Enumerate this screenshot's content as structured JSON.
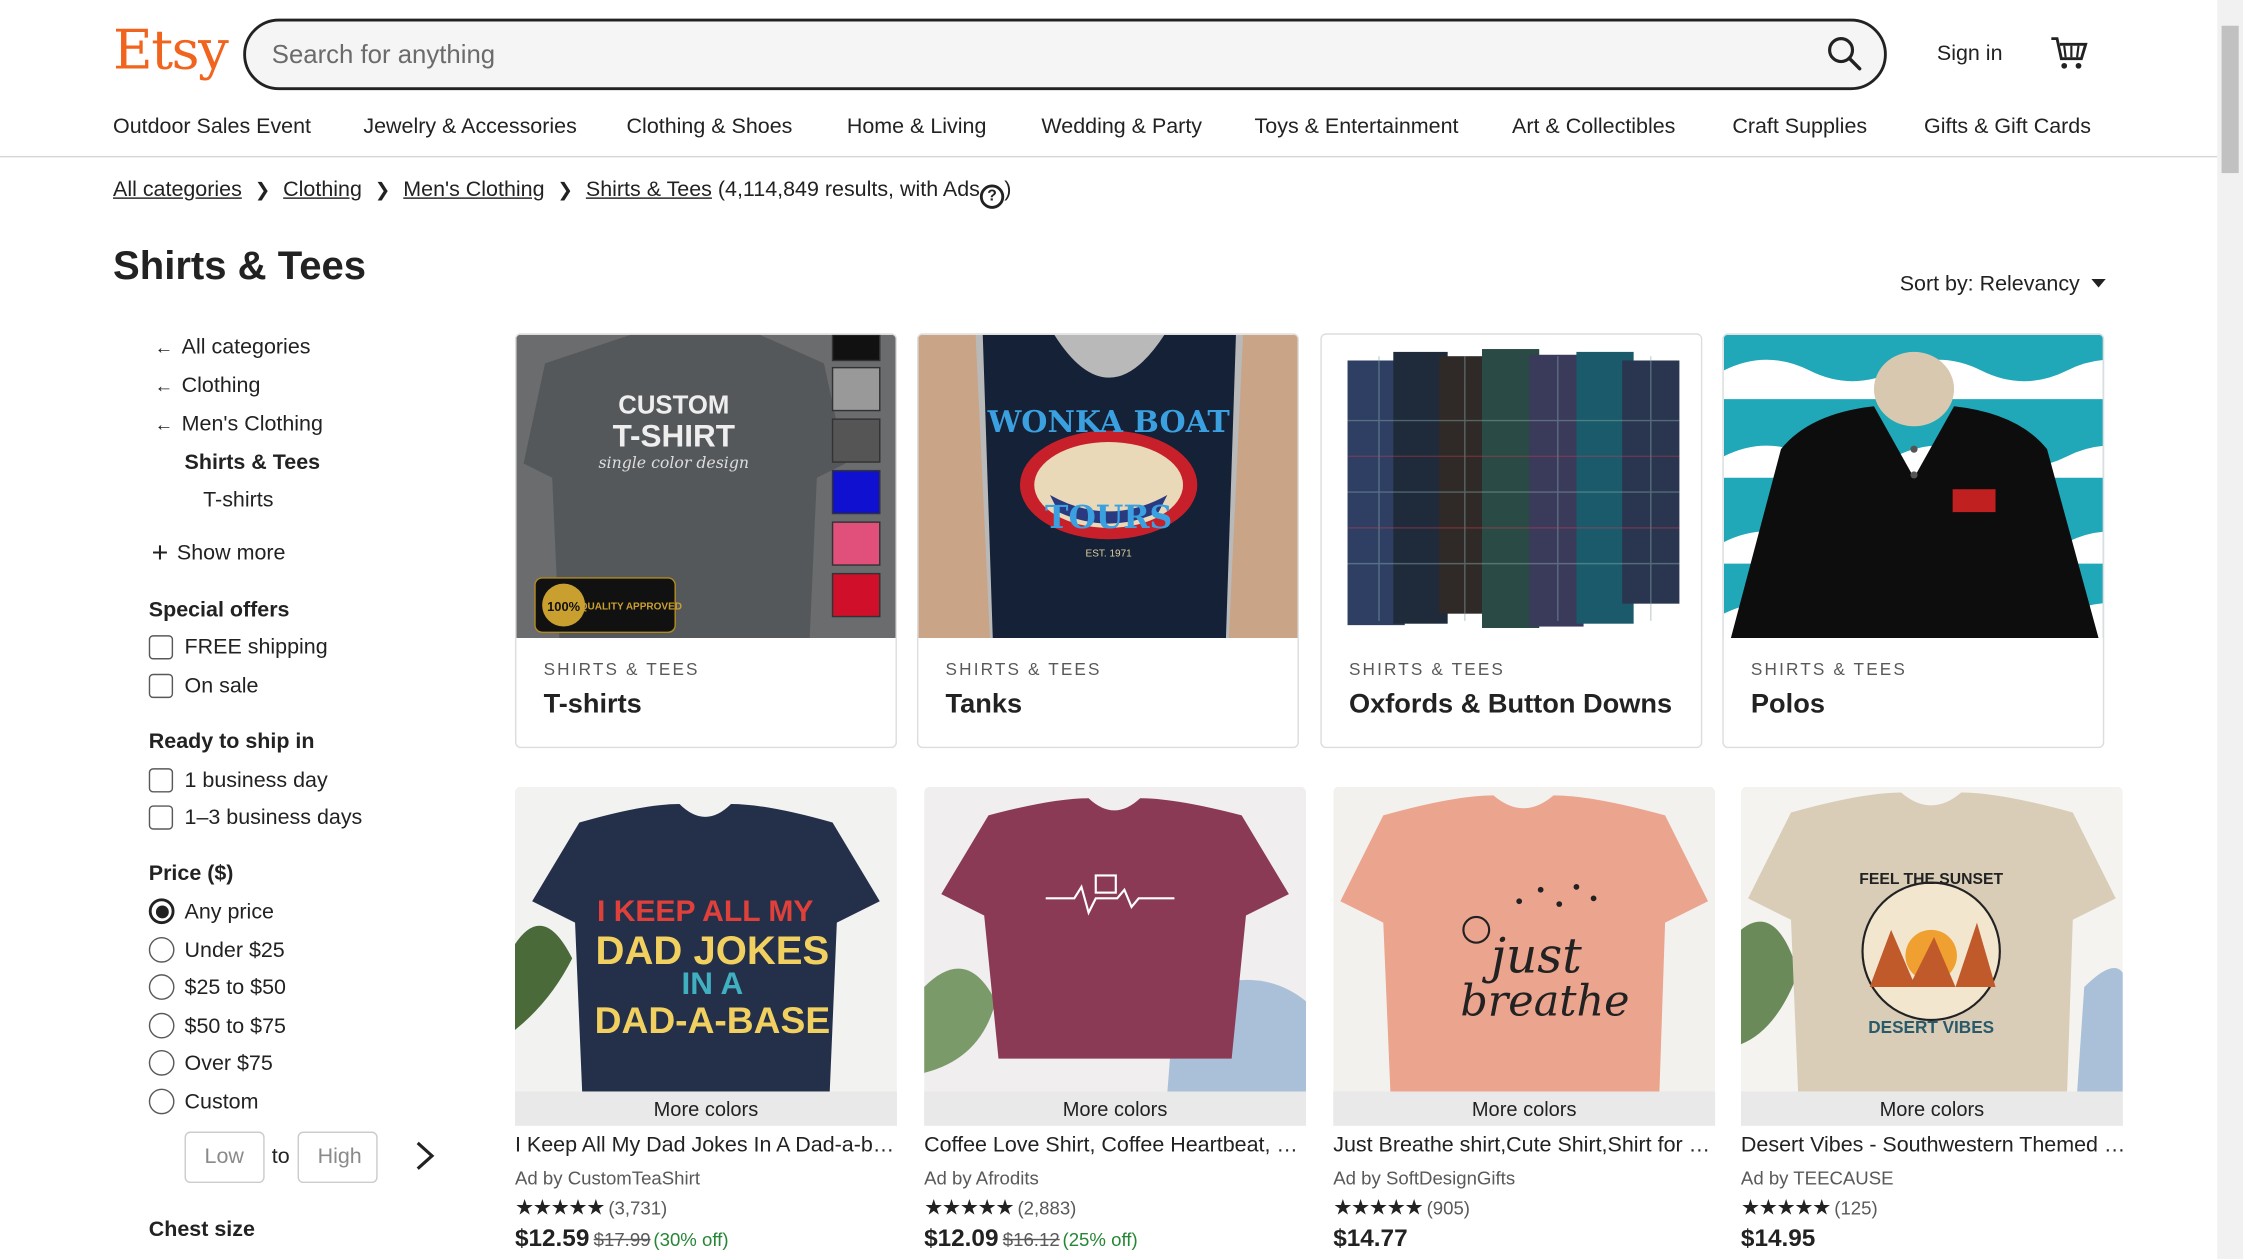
{
  "header": {
    "logo": "Etsy",
    "search_placeholder": "Search for anything",
    "sign_in": "Sign in"
  },
  "categories": [
    "Outdoor Sales Event",
    "Jewelry & Accessories",
    "Clothing & Shoes",
    "Home & Living",
    "Wedding & Party",
    "Toys & Entertainment",
    "Art & Collectibles",
    "Craft Supplies",
    "Gifts & Gift Cards"
  ],
  "breadcrumb": {
    "items": [
      "All categories",
      "Clothing",
      "Men's Clothing",
      "Shirts & Tees"
    ],
    "results": "(4,114,849 results, with Ads",
    "close": ")"
  },
  "page_title": "Shirts & Tees",
  "sort": "Sort by: Relevancy",
  "sidebar": {
    "nav": [
      "All categories",
      "Clothing",
      "Men's Clothing"
    ],
    "current": "Shirts & Tees",
    "child": "T-shirts",
    "show_more": "Show more",
    "special_offers": {
      "title": "Special offers",
      "options": [
        "FREE shipping",
        "On sale"
      ]
    },
    "ready_to_ship": {
      "title": "Ready to ship in",
      "options": [
        "1 business day",
        "1–3 business days"
      ]
    },
    "price": {
      "title": "Price ($)",
      "options": [
        "Any price",
        "Under $25",
        "$25 to $50",
        "$50 to $75",
        "Over $75",
        "Custom"
      ],
      "selected": "Any price",
      "low_placeholder": "Low",
      "to": "to",
      "high_placeholder": "High"
    },
    "chest_size": "Chest size"
  },
  "tiles": [
    {
      "kicker": "SHIRTS & TEES",
      "label": "T-shirts"
    },
    {
      "kicker": "SHIRTS & TEES",
      "label": "Tanks"
    },
    {
      "kicker": "SHIRTS & TEES",
      "label": "Oxfords & Button Downs"
    },
    {
      "kicker": "SHIRTS & TEES",
      "label": "Polos"
    }
  ],
  "tile_art": {
    "tshirt_line1": "CUSTOM",
    "tshirt_line2": "T-SHIRT",
    "tshirt_line3": "single color design",
    "badge": "100%",
    "badge_text": "QUALITY APPROVED",
    "tank_line1": "WONKA BOAT",
    "tank_line2": "TOURS",
    "tank_line3": "EST. 1971"
  },
  "listings": [
    {
      "more": "More colors",
      "name": "I Keep All My Dad Jokes In A Dad-a-base Shirt",
      "shop": "Ad by CustomTeaShirt",
      "stars": "★★★★★",
      "reviews": "(3,731)",
      "price": "$12.59",
      "was": "$17.99",
      "off": "(30% off)",
      "art": [
        "I KEEP ALL MY",
        "DAD JOKES",
        "IN A",
        "DAD-A-BASE"
      ]
    },
    {
      "more": "More colors",
      "name": "Coffee Love Shirt, Coffee Heartbeat, Coffee Lover Gift",
      "shop": "Ad by Afrodits",
      "stars": "★★★★★",
      "reviews": "(2,883)",
      "price": "$12.09",
      "was": "$16.12",
      "off": "(25% off)",
      "art": []
    },
    {
      "more": "More colors",
      "name": "Just Breathe shirt,Cute Shirt,Shirt for Women",
      "shop": "Ad by SoftDesignGifts",
      "stars": "★★★★★",
      "reviews": "(905)",
      "price": "$14.77",
      "was": "",
      "off": "",
      "art": [
        "just",
        "breathe"
      ]
    },
    {
      "more": "More colors",
      "name": "Desert Vibes - Southwestern Themed Shirt",
      "shop": "Ad by TEECAUSE",
      "stars": "★★★★★",
      "reviews": "(125)",
      "price": "$14.95",
      "was": "",
      "off": "",
      "art": [
        "FEEL THE SUNSET",
        "DESERT VIBES"
      ]
    }
  ],
  "colors": {
    "brand": "#f1641e",
    "sale_green": "#258635"
  }
}
